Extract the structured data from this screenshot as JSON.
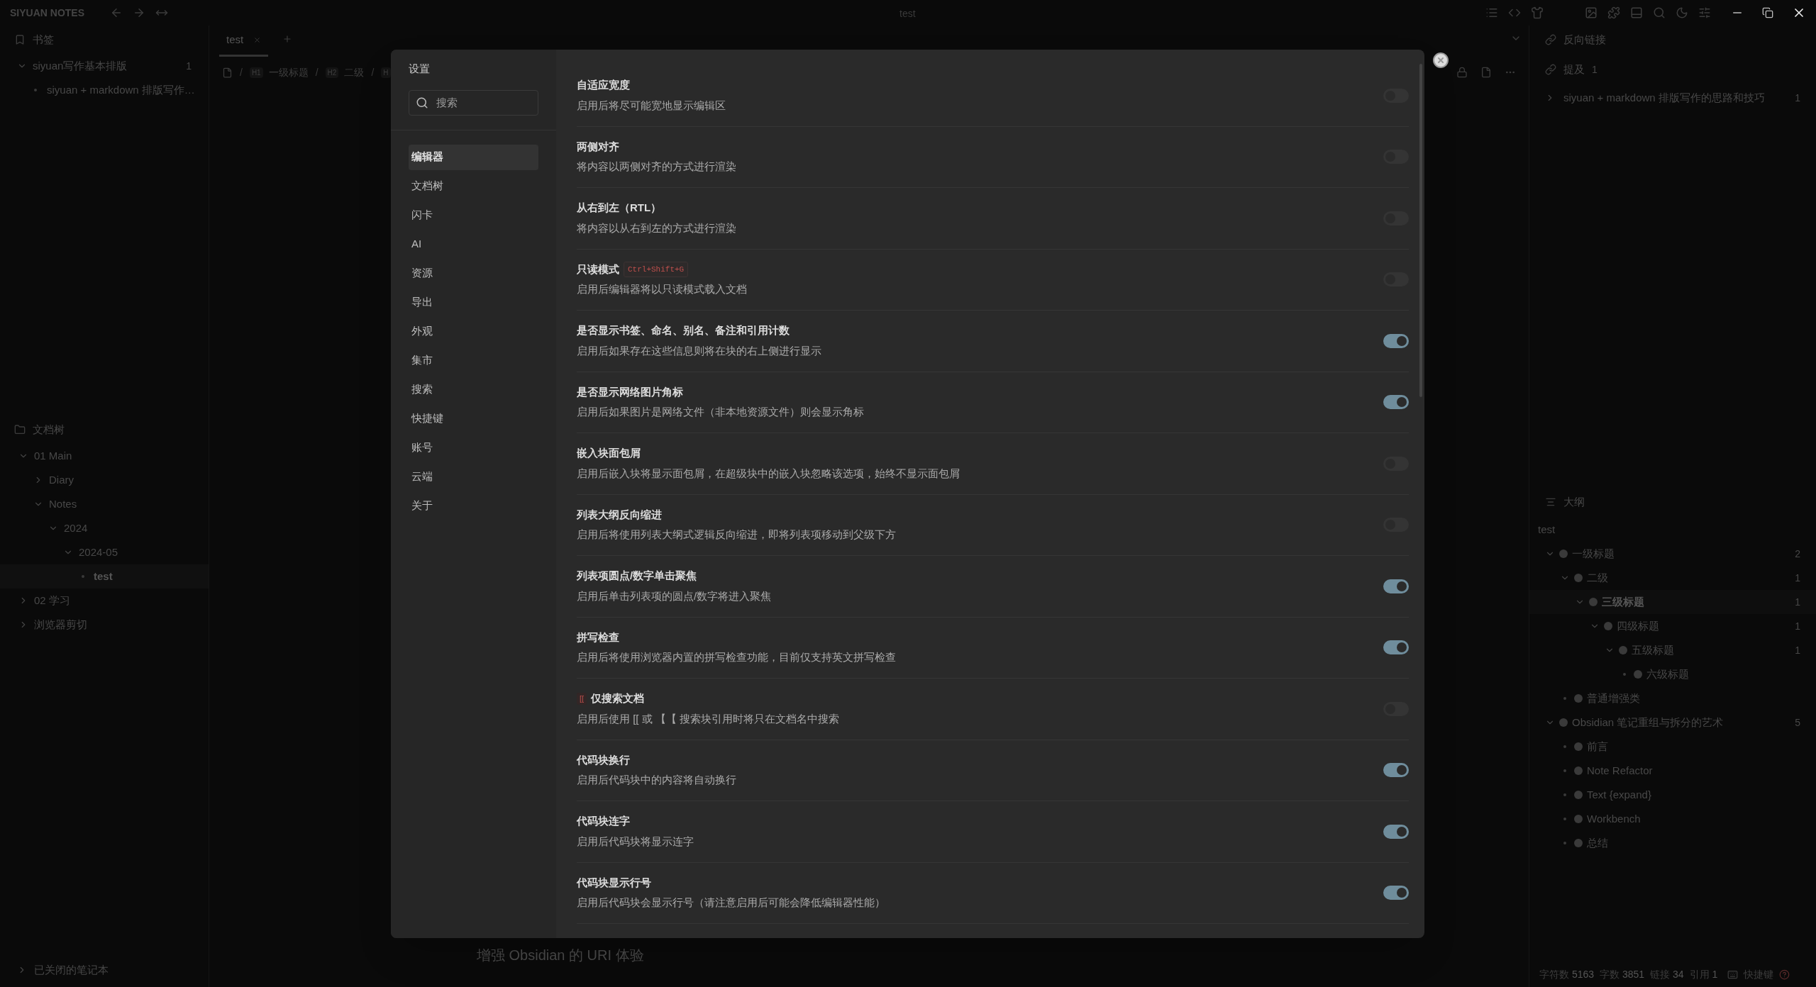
{
  "titlebar": {
    "app_name": "SIYUAN NOTES",
    "title": "test"
  },
  "bookmarks": {
    "title": "书签",
    "items": [
      {
        "label": "siyuan写作基本排版",
        "count": "1",
        "expanded": true,
        "children": [
          {
            "label": "siyuan + markdown 排版写作…"
          }
        ]
      }
    ]
  },
  "file_tree": {
    "title": "文档树",
    "items": [
      {
        "label": "01 Main",
        "expanded": true,
        "selected": false,
        "children": [
          {
            "label": "Diary",
            "expanded": false,
            "selected": false
          },
          {
            "label": "Notes",
            "expanded": true,
            "selected": false,
            "children": [
              {
                "label": "2024",
                "expanded": true,
                "selected": false,
                "children": [
                  {
                    "label": "2024-05",
                    "expanded": true,
                    "selected": false,
                    "children": [
                      {
                        "label": "test",
                        "selected": true
                      }
                    ]
                  }
                ]
              }
            ]
          }
        ]
      },
      {
        "label": "02 学习",
        "expanded": false,
        "selected": false
      },
      {
        "label": "浏览器剪切",
        "expanded": false,
        "selected": false
      }
    ],
    "footer": "已关闭的笔记本"
  },
  "tabs": [
    {
      "label": "test",
      "selected": true
    }
  ],
  "breadcrumb_separator": "/",
  "breadcrumb": [
    {
      "badge": "H1",
      "label": "一级标题"
    },
    {
      "badge": "H2",
      "label": "二级"
    },
    {
      "badge": "H"
    }
  ],
  "editor": {
    "visible_heading": "增强 Obsidian 的 URI 体验"
  },
  "backlinks": {
    "title": "反向链接",
    "mentions_label": "提及",
    "mentions_count": "1",
    "items": [
      {
        "label": "siyuan + markdown 排版写作的思路和技巧",
        "count": "1"
      }
    ]
  },
  "outline": {
    "title": "大纲",
    "doc": "test",
    "items": [
      {
        "label": "一级标题",
        "count": "2",
        "expanded": true,
        "selected": false,
        "children": [
          {
            "label": "二级",
            "count": "1",
            "expanded": true,
            "selected": false,
            "children": [
              {
                "label": "三级标题",
                "count": "1",
                "expanded": true,
                "selected": true,
                "children": [
                  {
                    "label": "四级标题",
                    "count": "1",
                    "expanded": true,
                    "selected": false,
                    "children": [
                      {
                        "label": "五级标题",
                        "count": "1",
                        "expanded": true,
                        "selected": false,
                        "children": [
                          {
                            "label": "六级标题",
                            "selected": false
                          }
                        ]
                      }
                    ]
                  }
                ]
              }
            ]
          },
          {
            "label": "普通增强类",
            "selected": false
          }
        ]
      },
      {
        "label": "Obsidian 笔记重组与拆分的艺术",
        "count": "5",
        "expanded": true,
        "selected": false,
        "children": [
          {
            "label": "前言",
            "selected": false
          },
          {
            "label": "Note Refactor",
            "selected": false
          },
          {
            "label": "Text {expand}",
            "selected": false
          },
          {
            "label": "Workbench",
            "selected": false
          },
          {
            "label": "总结",
            "selected": false
          }
        ]
      }
    ]
  },
  "status_bar": {
    "stats": [
      {
        "label": "字符数",
        "value": "5163"
      },
      {
        "label": "字数",
        "value": "3851"
      },
      {
        "label": "链接",
        "value": "34"
      },
      {
        "label": "引用",
        "value": "1"
      }
    ],
    "shortcuts": "快捷键"
  },
  "settings": {
    "title": "设置",
    "search": {
      "placeholder": "搜索"
    },
    "nav": [
      {
        "label": "编辑器",
        "selected": true
      },
      {
        "label": "文档树",
        "selected": false
      },
      {
        "label": "闪卡",
        "selected": false
      },
      {
        "label": "AI",
        "selected": false
      },
      {
        "label": "资源",
        "selected": false
      },
      {
        "label": "导出",
        "selected": false
      },
      {
        "label": "外观",
        "selected": false
      },
      {
        "label": "集市",
        "selected": false
      },
      {
        "label": "搜索",
        "selected": false
      },
      {
        "label": "快捷键",
        "selected": false
      },
      {
        "label": "账号",
        "selected": false
      },
      {
        "label": "云端",
        "selected": false
      },
      {
        "label": "关于",
        "selected": false
      }
    ],
    "options": [
      {
        "title": "自适应宽度",
        "desc": "启用后将尽可能宽地显示编辑区",
        "on": false
      },
      {
        "title": "两侧对齐",
        "desc": "将内容以两侧对齐的方式进行渲染",
        "on": false
      },
      {
        "title": "从右到左（RTL）",
        "desc": "将内容以从右到左的方式进行渲染",
        "on": false
      },
      {
        "title": "只读模式",
        "shortcut": "Ctrl+Shift+G",
        "desc": "启用后编辑器将以只读模式载入文档",
        "on": false
      },
      {
        "title": "是否显示书签、命名、别名、备注和引用计数",
        "desc": "启用后如果存在这些信息则将在块的右上侧进行显示",
        "on": true
      },
      {
        "title": "是否显示网络图片角标",
        "desc": "启用后如果图片是网络文件（非本地资源文件）则会显示角标",
        "on": true
      },
      {
        "title": "嵌入块面包屑",
        "desc": "启用后嵌入块将显示面包屑，在超级块中的嵌入块忽略该选项，始终不显示面包屑",
        "on": false
      },
      {
        "title": "列表大纲反向缩进",
        "desc": "启用后将使用列表大纲式逻辑反向缩进，即将列表项移动到父级下方",
        "on": false
      },
      {
        "title": "列表项圆点/数字单击聚焦",
        "desc": "启用后单击列表项的圆点/数字将进入聚焦",
        "on": true
      },
      {
        "title": "拼写检查",
        "desc": "启用后将使用浏览器内置的拼写检查功能，目前仅支持英文拼写检查",
        "on": true
      },
      {
        "prefix": "[[",
        "title": "仅搜索文档",
        "desc": "启用后使用 [[ 或 【【 搜索块引用时将只在文档名中搜索",
        "on": false
      },
      {
        "title": "代码块换行",
        "desc": "启用后代码块中的内容将自动换行",
        "on": true
      },
      {
        "title": "代码块连字",
        "desc": "启用后代码块将显示连字",
        "on": true
      },
      {
        "title": "代码块显示行号",
        "desc": "启用后代码块会显示行号（请注意启用后可能会降低编辑器性能）",
        "on": true
      }
    ]
  }
}
